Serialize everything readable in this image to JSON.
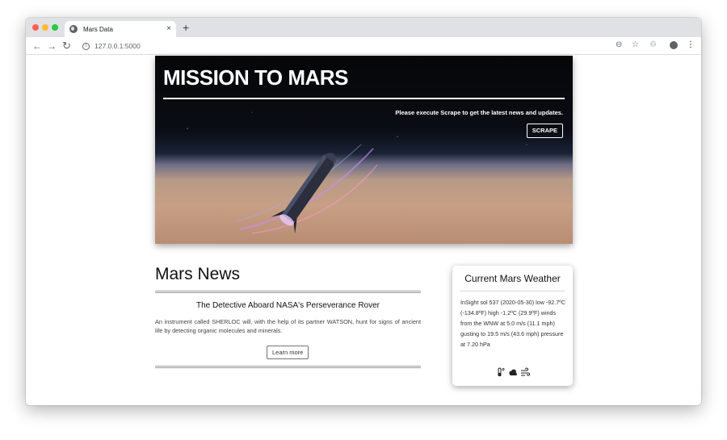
{
  "browser": {
    "tab_title": "Mars Data",
    "tab_close": "×",
    "new_tab": "+",
    "url": "127.0.0.1:5000",
    "back": "←",
    "forward": "→",
    "reload": "↻",
    "zoom": "⊖",
    "star": "☆",
    "extension": "♲",
    "menu": "⋮"
  },
  "hero": {
    "title": "MISSION TO MARS",
    "lead": "Please execute Scrape to get the latest news and updates.",
    "button_label": "SCRAPE"
  },
  "news": {
    "heading": "Mars News",
    "article_title": "The Detective Aboard NASA's Perseverance Rover",
    "article_body": "An instrument called SHERLOC will, with the help of its partner WATSON, hunt for signs of ancient life by detecting organic molecules and minerals.",
    "button_label": "Learn more"
  },
  "weather": {
    "title": "Current Mars Weather",
    "text": "InSight sol 537 (2020-05-30) low -92.7ºC (-134.8ºF) high -1.2ºC (29.9ºF) winds from the WNW at 5.0 m/s (11.1 mph) gusting to 19.5 m/s (43.6 mph) pressure at 7.20 hPa",
    "icons": [
      "thermometer-icon",
      "cloud-icon",
      "wind-icon"
    ]
  },
  "colors": {
    "hero_text": "#ffffff",
    "traffic_red": "#ff5f57",
    "traffic_yellow": "#febc2e",
    "traffic_green": "#28c840"
  }
}
